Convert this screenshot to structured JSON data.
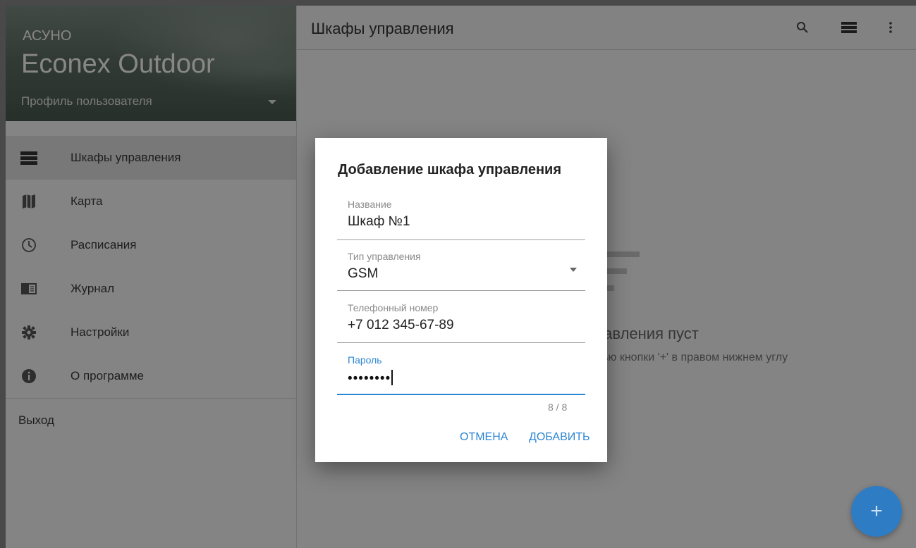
{
  "sidebar": {
    "app_name": "АСУНО",
    "product_name": "Econex Outdoor",
    "profile_label": "Профиль пользователя",
    "items": [
      {
        "label": "Шкафы управления",
        "icon": "cabinets-icon",
        "active": true
      },
      {
        "label": "Карта",
        "icon": "map-icon"
      },
      {
        "label": "Расписания",
        "icon": "clock-icon"
      },
      {
        "label": "Журнал",
        "icon": "journal-icon"
      },
      {
        "label": "Настройки",
        "icon": "gear-icon"
      },
      {
        "label": "О программе",
        "icon": "info-icon"
      }
    ],
    "logout_label": "Выход"
  },
  "appbar": {
    "title": "Шкафы управления",
    "actions": [
      "search-icon",
      "view-list-icon",
      "more-vert-icon"
    ]
  },
  "main": {
    "empty_title": "управления пуст",
    "empty_hint": "мощью кнопки '+' в правом нижнем углу"
  },
  "fab": {
    "label": "+"
  },
  "dialog": {
    "title": "Добавление шкафа управления",
    "fields": {
      "name": {
        "label": "Название",
        "value": "Шкаф №1"
      },
      "control_type": {
        "label": "Тип управления",
        "value": "GSM"
      },
      "phone": {
        "label": "Телефонный номер",
        "value": "+7 012 345-67-89"
      },
      "password": {
        "label": "Пароль",
        "value": "••••••••",
        "counter": "8 / 8"
      }
    },
    "cancel_label": "ОТМЕНА",
    "add_label": "ДОБАВИТЬ"
  },
  "colors": {
    "accent": "#2d86d3",
    "fab": "#2e7cc4",
    "overlay": "rgba(0,0,0,0.47)"
  }
}
